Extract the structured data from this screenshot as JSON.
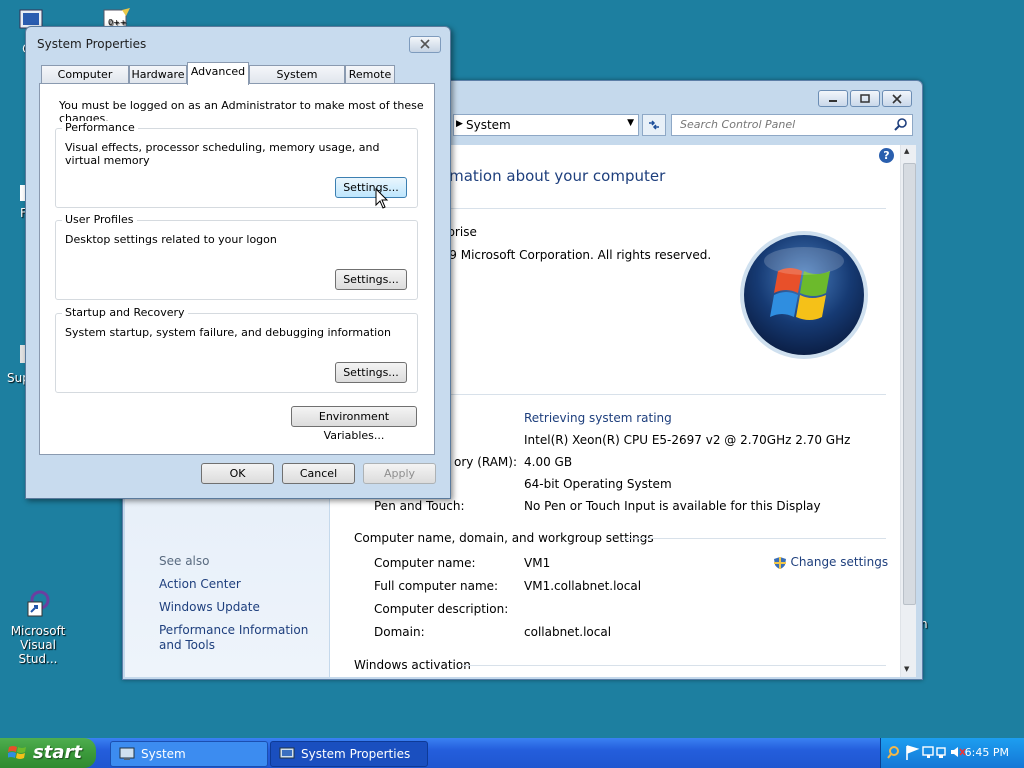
{
  "desktop": {
    "icons": [
      {
        "label": "Co"
      },
      {
        "label": "F"
      },
      {
        "label": "Sup"
      },
      {
        "label": "Microsoft Visual Stud..."
      },
      {
        "label": "n"
      }
    ]
  },
  "system_window": {
    "address_path": "System",
    "search_placeholder": "Search Control Panel",
    "heading": "ormation about your computer",
    "edition_fragment": "erprise",
    "copyright": "009 Microsoft Corporation.  All rights reserved.",
    "see_also": "See also",
    "left_links": [
      "Action Center",
      "Windows Update",
      "Performance Information and Tools"
    ],
    "rows": [
      {
        "label": "",
        "value": "Retrieving system rating",
        "is_link": true
      },
      {
        "label": "",
        "value": "Intel(R) Xeon(R) CPU E5-2697 v2 @ 2.70GHz   2.70 GHz"
      },
      {
        "label": "ory (RAM):",
        "value": "4.00 GB"
      },
      {
        "label": "",
        "value": "64-bit Operating System"
      },
      {
        "label": "Pen and Touch:",
        "value": "No Pen or Touch Input is available for this Display"
      }
    ],
    "section_computer_name": "Computer name, domain, and workgroup settings",
    "name_rows": [
      {
        "label": "Computer name:",
        "value": "VM1"
      },
      {
        "label": "Full computer name:",
        "value": "VM1.collabnet.local"
      },
      {
        "label": "Computer description:",
        "value": ""
      },
      {
        "label": "Domain:",
        "value": "collabnet.local"
      }
    ],
    "change_settings": "Change settings",
    "section_activation": "Windows activation"
  },
  "dialog": {
    "title": "System Properties",
    "tabs": [
      "Computer Name",
      "Hardware",
      "Advanced",
      "System Protection",
      "Remote"
    ],
    "active_tab": "Advanced",
    "admin_note": "You must be logged on as an Administrator to make most of these changes.",
    "groups": [
      {
        "legend": "Performance",
        "desc": "Visual effects, processor scheduling, memory usage, and virtual memory",
        "button": "Settings..."
      },
      {
        "legend": "User Profiles",
        "desc": "Desktop settings related to your logon",
        "button": "Settings..."
      },
      {
        "legend": "Startup and Recovery",
        "desc": "System startup, system failure, and debugging information",
        "button": "Settings..."
      }
    ],
    "env_button": "Environment Variables...",
    "ok": "OK",
    "cancel": "Cancel",
    "apply": "Apply"
  },
  "taskbar": {
    "start_label": "start",
    "tasks": [
      "System",
      "System Properties"
    ],
    "clock": "6:45 PM"
  }
}
